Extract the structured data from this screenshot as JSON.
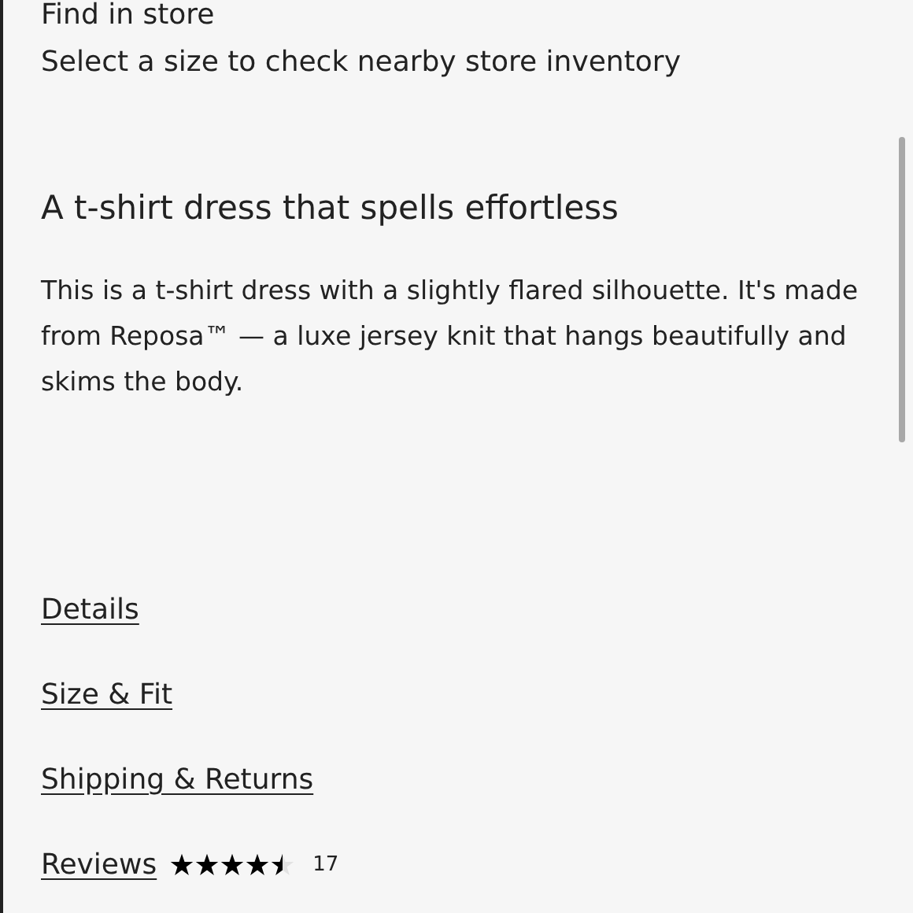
{
  "store": {
    "title": "Find in store",
    "hint": "Select a size to check nearby store inventory"
  },
  "description": {
    "heading": "A t-shirt dress that spells effortless",
    "body": "This is a t-shirt dress with a slightly flared silhouette. It's made from Reposa™ — a luxe jersey knit that hangs beautifully and skims the body."
  },
  "links": [
    {
      "label": "Details",
      "kind": "link"
    },
    {
      "label": "Size & Fit",
      "kind": "link"
    },
    {
      "label": "Shipping & Returns",
      "kind": "link"
    },
    {
      "label": "Reviews",
      "kind": "reviews",
      "stars": 4.5,
      "count": "17"
    }
  ]
}
